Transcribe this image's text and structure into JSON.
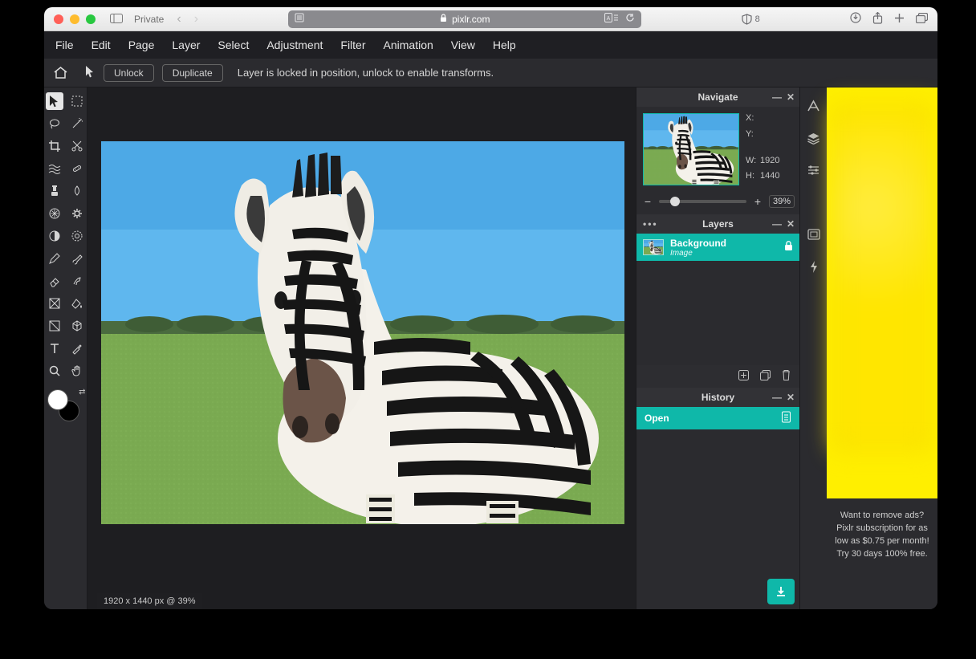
{
  "browser": {
    "private_label": "Private",
    "url_host": "pixlr.com",
    "shield_count": "8"
  },
  "menu": {
    "items": [
      "File",
      "Edit",
      "Page",
      "Layer",
      "Select",
      "Adjustment",
      "Filter",
      "Animation",
      "View",
      "Help"
    ]
  },
  "toolbar": {
    "unlock_label": "Unlock",
    "duplicate_label": "Duplicate",
    "message": "Layer is locked in position, unlock to enable transforms."
  },
  "tools": [
    "arrow",
    "marquee",
    "lasso",
    "wand",
    "crop",
    "scissors",
    "liquify",
    "heal",
    "clone",
    "blur-drop",
    "pixelate",
    "gear",
    "contrast",
    "sun",
    "pencil",
    "brush",
    "eraser",
    "pattern",
    "shape",
    "bucket",
    "frame",
    "rotate3d",
    "text",
    "eyedropper",
    "zoom",
    "hand"
  ],
  "canvas": {
    "status": "1920 x 1440 px @ 39%"
  },
  "navigate": {
    "title": "Navigate",
    "x_label": "X:",
    "y_label": "Y:",
    "w_label": "W:",
    "h_label": "H:",
    "w_value": "1920",
    "h_value": "1440",
    "zoom": "39%"
  },
  "layers": {
    "title": "Layers",
    "items": [
      {
        "name": "Background",
        "type": "Image",
        "locked": true
      }
    ]
  },
  "history": {
    "title": "History",
    "items": [
      {
        "label": "Open"
      }
    ]
  },
  "ad": {
    "line1": "Want to remove ads?",
    "line2": "Pixlr subscription for as low as $0.75 per month!",
    "line3": "Try 30 days 100% free."
  }
}
